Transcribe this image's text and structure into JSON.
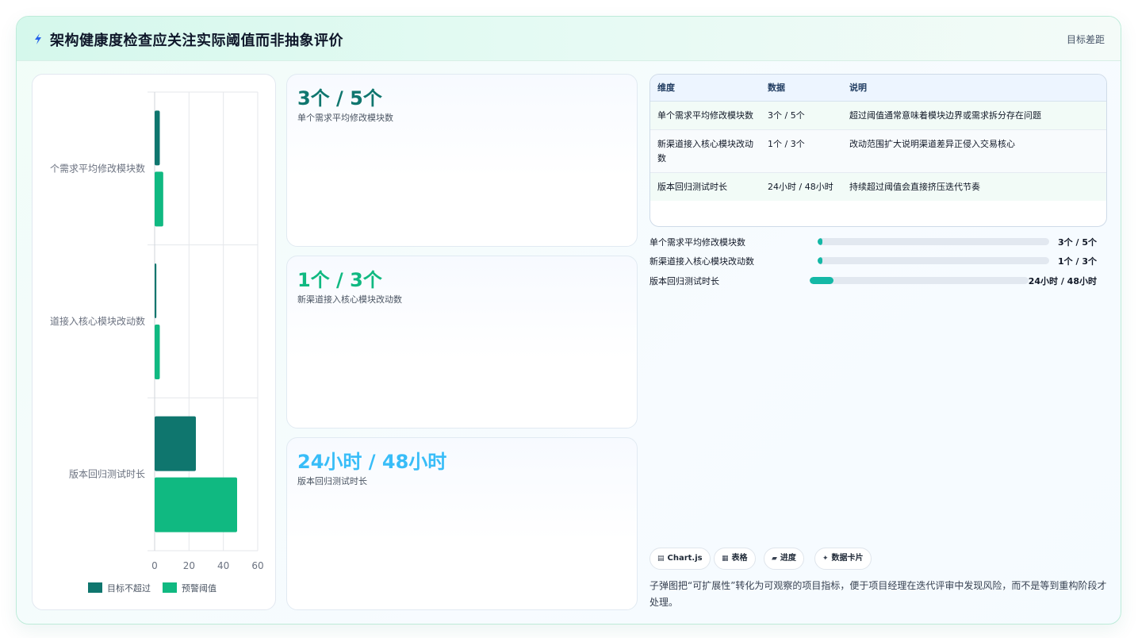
{
  "header": {
    "title": "架构健康度检查应关注实际阈值而非抽象评价",
    "right_label": "目标差距"
  },
  "chart_data": {
    "type": "bar",
    "orientation": "horizontal",
    "categories": [
      "个需求平均修改模块数",
      "道接入核心模块改动数",
      "版本回归测试时长"
    ],
    "series": [
      {
        "name": "目标不超过",
        "values": [
          3,
          1,
          24
        ],
        "color": "#0f766e"
      },
      {
        "name": "预警阈值",
        "values": [
          5,
          3,
          48
        ],
        "color": "#10b981"
      }
    ],
    "xlim": [
      0,
      60
    ],
    "xticks": [
      0,
      20,
      40,
      60
    ],
    "grid": true,
    "legend_position": "bottom"
  },
  "cards": [
    {
      "value": "3个 / 5个",
      "label": "单个需求平均修改模块数",
      "color": "#0f766e"
    },
    {
      "value": "1个 / 3个",
      "label": "新渠道接入核心模块改动数",
      "color": "#10b981"
    },
    {
      "value": "24小时 / 48小时",
      "label": "版本回归测试时长",
      "color": "#38bdf8"
    }
  ],
  "table": {
    "headers": [
      "维度",
      "数据",
      "说明"
    ],
    "rows": [
      [
        "单个需求平均修改模块数",
        "3个 / 5个",
        "超过阈值通常意味着模块边界或需求拆分存在问题"
      ],
      [
        "新渠道接入核心模块改动数",
        "1个 / 3个",
        "改动范围扩大说明渠道差异正侵入交易核心"
      ],
      [
        "版本回归测试时长",
        "24小时 / 48小时",
        "持续超过阈值会直接挤压迭代节奏"
      ]
    ]
  },
  "progress": [
    {
      "label": "单个需求平均修改模块数",
      "value": "3个 / 5个",
      "fraction": 0.02
    },
    {
      "label": "新渠道接入核心模块改动数",
      "value": "1个 / 3个",
      "fraction": 0.02
    },
    {
      "label": "版本回归测试时长",
      "value": "24小时 / 48小时",
      "fraction": 0.11
    }
  ],
  "tags": [
    {
      "icon": "▤",
      "label": "Chart.js",
      "icon_name": "chart-icon"
    },
    {
      "icon": "▦",
      "label": "表格",
      "icon_name": "table-icon"
    },
    {
      "icon": "▰",
      "label": "进度",
      "icon_name": "progress-icon"
    },
    {
      "icon": "✦",
      "label": "数据卡片",
      "icon_name": "sparkle-icon"
    }
  ],
  "note": "子弹图把“可扩展性”转化为可观察的项目指标，便于项目经理在迭代评审中发现风险，而不是等到重构阶段才处理。"
}
